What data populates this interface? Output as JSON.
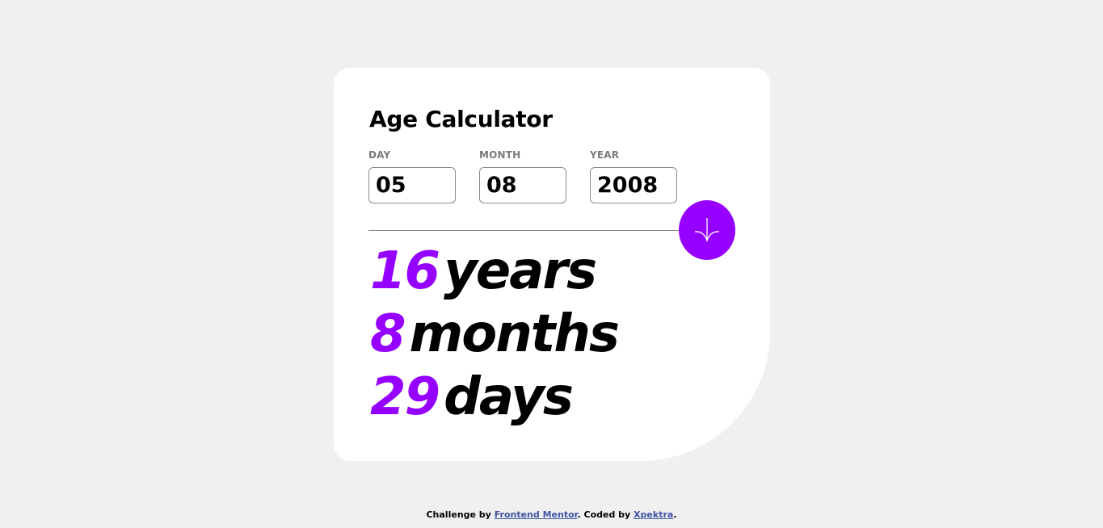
{
  "card": {
    "title": "Age Calculator",
    "fields": {
      "day": {
        "label": "DAY",
        "value": "05"
      },
      "month": {
        "label": "MONTH",
        "value": "08"
      },
      "year": {
        "label": "YEAR",
        "value": "2008"
      }
    },
    "submit": {
      "icon": "arrow-down-icon",
      "color": "#9500ff"
    },
    "results": {
      "years": {
        "number": "16",
        "unit": "years"
      },
      "months": {
        "number": "8",
        "unit": "months"
      },
      "days": {
        "number": "29",
        "unit": "days"
      }
    }
  },
  "footer": {
    "prefix": "Challenge by",
    "challenge_link": "Frontend Mentor",
    "middle": ". Coded by",
    "author_link": "Xpektra",
    "suffix": "."
  },
  "colors": {
    "accent": "#9500ff",
    "background": "#f0f0f0",
    "card": "#ffffff",
    "link": "#3e52a3"
  }
}
